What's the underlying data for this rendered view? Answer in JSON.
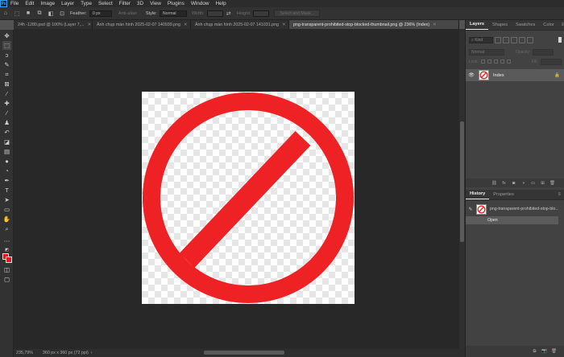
{
  "menubar": {
    "logo": "Ps",
    "items": [
      "File",
      "Edit",
      "Image",
      "Layer",
      "Type",
      "Select",
      "Filter",
      "3D",
      "View",
      "Plugins",
      "Window",
      "Help"
    ]
  },
  "options_bar": {
    "feather_label": "Feather:",
    "feather_value": "0 px",
    "anti_alias_label": "Anti-alias",
    "style_label": "Style:",
    "style_value": "Normal",
    "width_label": "Width:",
    "height_label": "Height:",
    "select_mask_label": "Select and Mask..."
  },
  "tabs": [
    {
      "label": "24h -1280.psd @ 100% (Layer 7,...",
      "active": false
    },
    {
      "label": "Ảnh chụp màn hình 2025-02-07 140939.png",
      "active": false
    },
    {
      "label": "Ảnh chụp màn hình 2025-02-07 141031.png",
      "active": false
    },
    {
      "label": "png-transparent-prohibited-stop-blocked-thumbnail.png @ 236% (Index)",
      "active": true
    }
  ],
  "status": {
    "zoom": "235,79%",
    "doc_size": "360 px x 360 px (72 ppi)"
  },
  "layers_panel": {
    "tabs": [
      "Layers",
      "Shapes",
      "Swatches",
      "Color"
    ],
    "filter_placeholder": "Kind",
    "blend_mode": "Normal",
    "opacity_label": "Opacity:",
    "lock_label": "Lock:",
    "fill_label": "Fill:",
    "layer_name": "Index"
  },
  "history_panel": {
    "tabs": [
      "History",
      "Properties"
    ],
    "snapshot_label": "png-transparent-prohibited-stop-blo...",
    "state_label": "Open"
  },
  "colors": {
    "foreground": "#e3171d",
    "prohibition_sign": "#ee2224"
  }
}
